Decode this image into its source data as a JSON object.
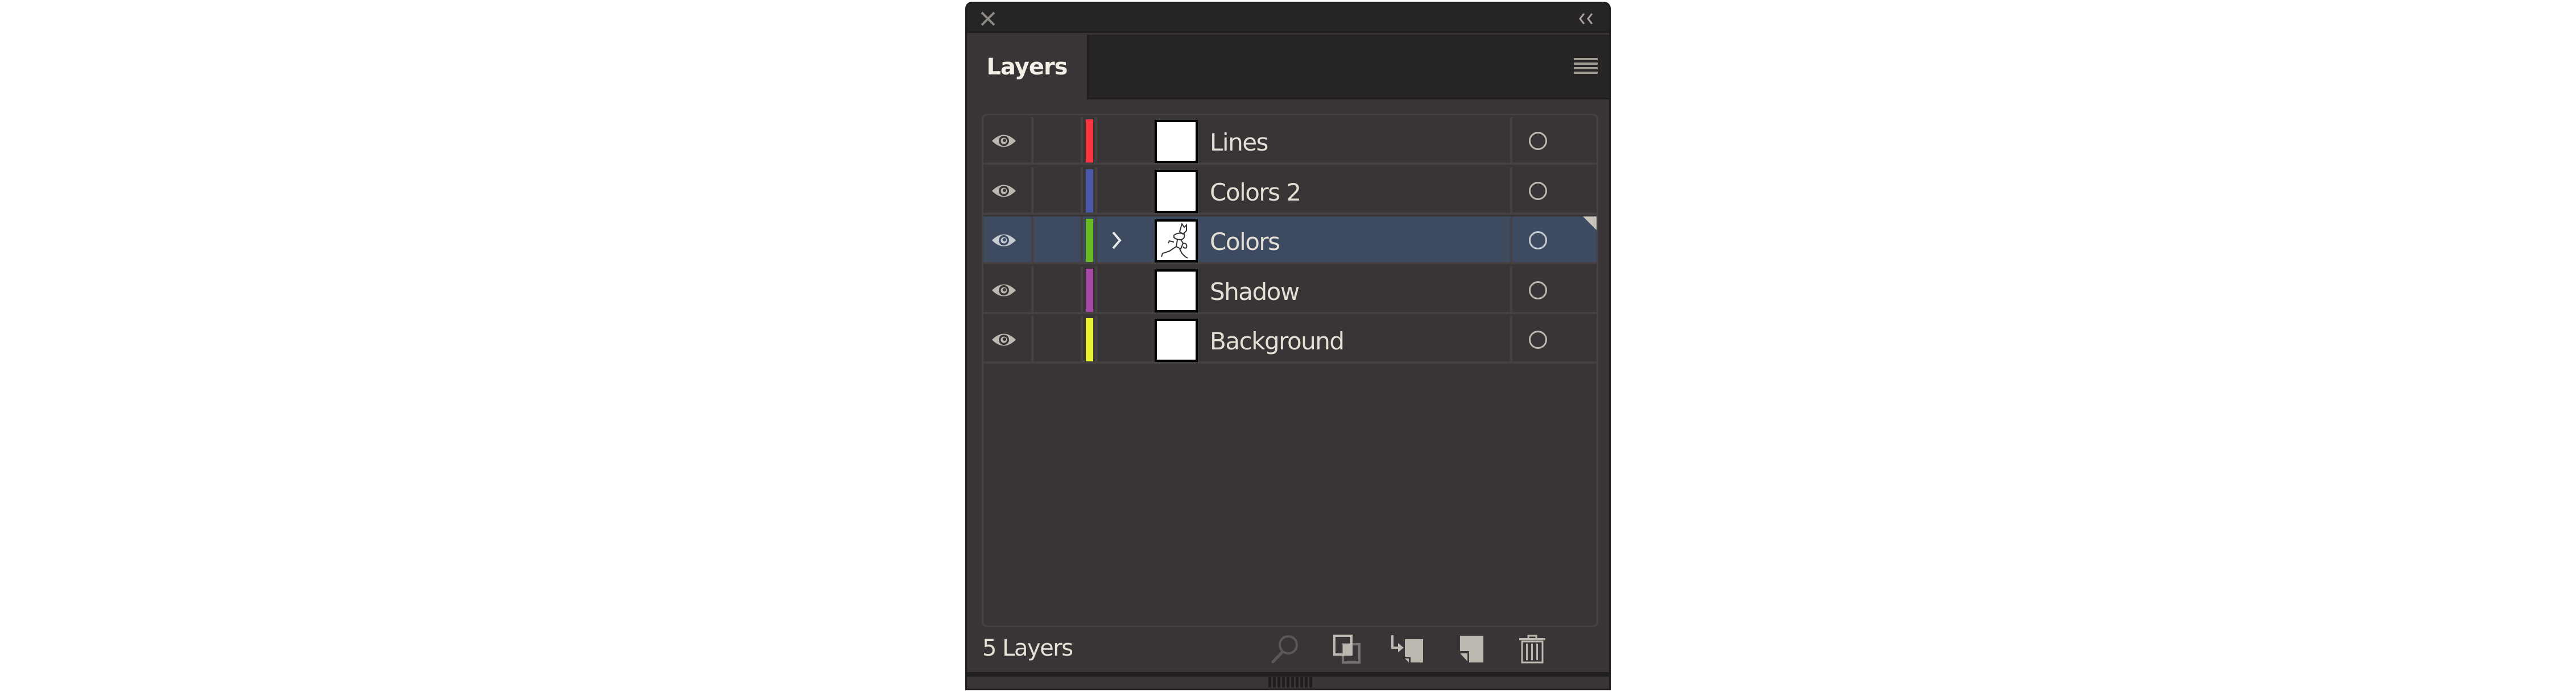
{
  "panel": {
    "title_tab": "Layers",
    "icons": {
      "close": "close-icon",
      "collapse": "double-chevron-left-icon",
      "menu": "hamburger-menu-icon"
    }
  },
  "layers": [
    {
      "name": "Lines",
      "color": "#fb3540",
      "visible": true,
      "selected": false,
      "has_children": false,
      "thumbnail": "blank"
    },
    {
      "name": "Colors 2",
      "color": "#4a58a8",
      "visible": true,
      "selected": false,
      "has_children": false,
      "thumbnail": "blank"
    },
    {
      "name": "Colors",
      "color": "#6abb21",
      "visible": true,
      "selected": true,
      "has_children": true,
      "thumbnail": "character-sketch"
    },
    {
      "name": "Shadow",
      "color": "#a44aa4",
      "visible": true,
      "selected": false,
      "has_children": false,
      "thumbnail": "blank"
    },
    {
      "name": "Background",
      "color": "#eaf236",
      "visible": true,
      "selected": false,
      "has_children": false,
      "thumbnail": "blank"
    }
  ],
  "footer": {
    "count_label": "5 Layers",
    "buttons": [
      {
        "name": "locate-object",
        "icon": "search-icon",
        "enabled": false
      },
      {
        "name": "make-clipping-mask",
        "icon": "clipping-mask-icon",
        "enabled": true
      },
      {
        "name": "create-sublayer",
        "icon": "new-sublayer-icon",
        "enabled": true
      },
      {
        "name": "create-new-layer",
        "icon": "new-layer-icon",
        "enabled": true
      },
      {
        "name": "delete-selection",
        "icon": "trash-icon",
        "enabled": true
      }
    ]
  },
  "colors": {
    "panel_bg": "#393536",
    "titlebar_bg": "#272425",
    "selected_row": "#3e4a5f",
    "text": "#e3e0d6",
    "icon": "#bcb9b0"
  }
}
